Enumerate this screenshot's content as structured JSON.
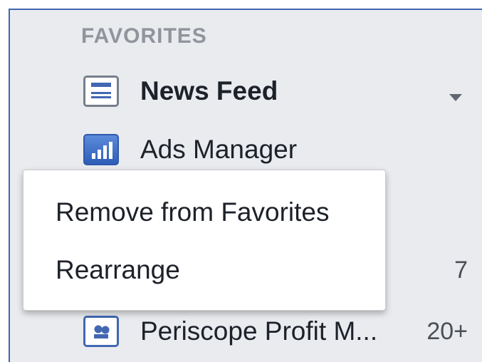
{
  "sidebar": {
    "section_title": "FAVORITES",
    "items": [
      {
        "label": "News Feed",
        "icon": "newsfeed-icon",
        "count": ""
      },
      {
        "label": "Ads Manager",
        "icon": "ads-manager-icon",
        "count": ""
      },
      {
        "label": "",
        "icon": "",
        "count": ""
      },
      {
        "label": "",
        "icon": "",
        "count": "7"
      },
      {
        "label": "Periscope Profit M...",
        "icon": "group-icon",
        "count": "20+"
      }
    ]
  },
  "context_menu": {
    "items": [
      {
        "label": "Remove from Favorites"
      },
      {
        "label": "Rearrange"
      }
    ]
  },
  "colors": {
    "accent": "#4267b2",
    "sidebar_background": "#e9ebee",
    "section_text": "#90949c",
    "text": "#1d2129"
  }
}
